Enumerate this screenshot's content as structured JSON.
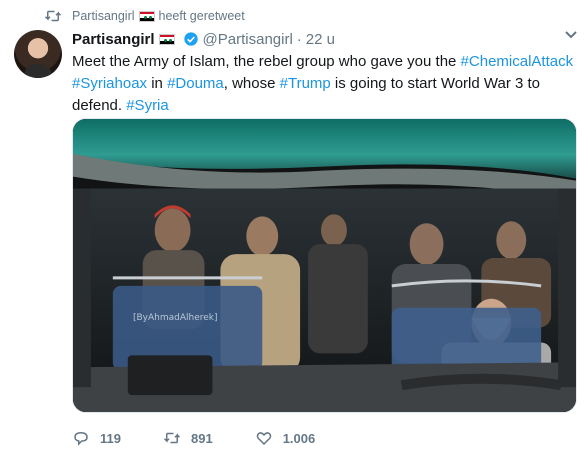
{
  "retweet": {
    "label": "Partisangirl",
    "suffix": "heeft geretweet"
  },
  "tweet": {
    "display_name": "Partisangirl",
    "handle": "@Partisangirl",
    "separator": "·",
    "time": "22 u",
    "text_parts": [
      "Meet the Army of Islam, the rebel group who gave you the ",
      "#ChemicalAttack",
      " ",
      "#Syriahoax",
      " in ",
      "#Douma",
      ", whose ",
      "#Trump",
      " is going to start World War 3 to defend. ",
      "#Syria"
    ],
    "image_watermark": "[ByAhmadAlherek]"
  },
  "actions": {
    "replies": "119",
    "retweets": "891",
    "likes": "1.006"
  },
  "colors": {
    "link": "#1b95e0",
    "muted": "#657786",
    "text": "#14171a",
    "verified": "#1da1f2"
  },
  "icons": [
    "retweet-icon",
    "syria-flag-icon",
    "verified-badge-icon",
    "chevron-down-icon",
    "reply-icon",
    "like-icon"
  ]
}
